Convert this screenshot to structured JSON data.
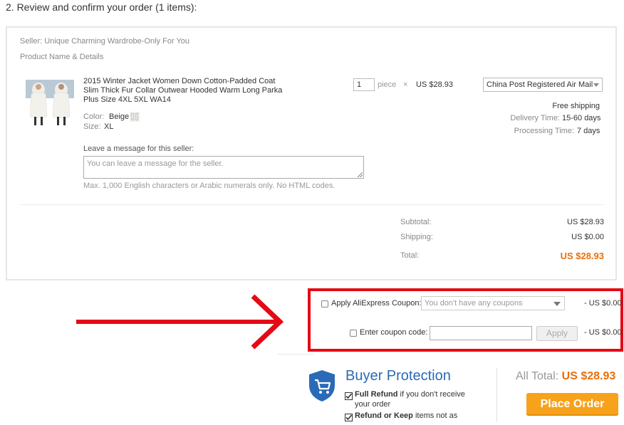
{
  "step_title": "2. Review and confirm your order (1 items):",
  "seller": "Seller: Unique Charming Wardrobe-Only For You",
  "product_header": "Product Name & Details",
  "product": {
    "name": "2015 Winter Jacket Women Down Cotton-Padded Coat Slim Thick Fur Collar Outwear Hooded Warm Long Parka Plus Size 4XL 5XL WA14",
    "color_label": "Color:",
    "color_value": "Beige",
    "size_label": "Size:",
    "size_value": "XL",
    "quantity": "1",
    "unit": "piece",
    "times": "×",
    "price": "US $28.93"
  },
  "shipping": {
    "method": "China Post Registered Air Mail",
    "free": "Free shipping",
    "delivery_label": "Delivery Time:",
    "delivery_value": "15-60 days",
    "processing_label": "Processing Time:",
    "processing_value": "7 days"
  },
  "message": {
    "label": "Leave a message for this seller:",
    "placeholder": "You can leave a message for the seller.",
    "hint": "Max. 1,000 English characters or Arabic numerals only. No HTML codes."
  },
  "summary": {
    "subtotal_label": "Subtotal:",
    "subtotal_value": "US $28.93",
    "shipping_label": "Shipping:",
    "shipping_value": "US $0.00",
    "total_label": "Total:",
    "total_value": "US $28.93"
  },
  "coupon": {
    "apply_label": "Apply AliExpress Coupon:",
    "select_text": "You don't have any coupons",
    "apply_discount": "- US $0.00",
    "code_label": "Enter coupon code:",
    "apply_button": "Apply",
    "code_discount": "- US $0.00"
  },
  "buyer_protection": {
    "title": "Buyer Protection",
    "line1_bold": "Full Refund",
    "line1_rest": " if you don't receive",
    "line1_cont": "your order",
    "line2_bold": "Refund or Keep",
    "line2_rest": " items not as"
  },
  "footer": {
    "all_total_label": "All Total:",
    "all_total_value": "US $28.93",
    "place_order": "Place Order"
  },
  "colors": {
    "accent_orange": "#e8700a",
    "button_orange": "#f7a21b",
    "annotation_red": "#e50914",
    "protection_blue": "#2a6ab6"
  }
}
